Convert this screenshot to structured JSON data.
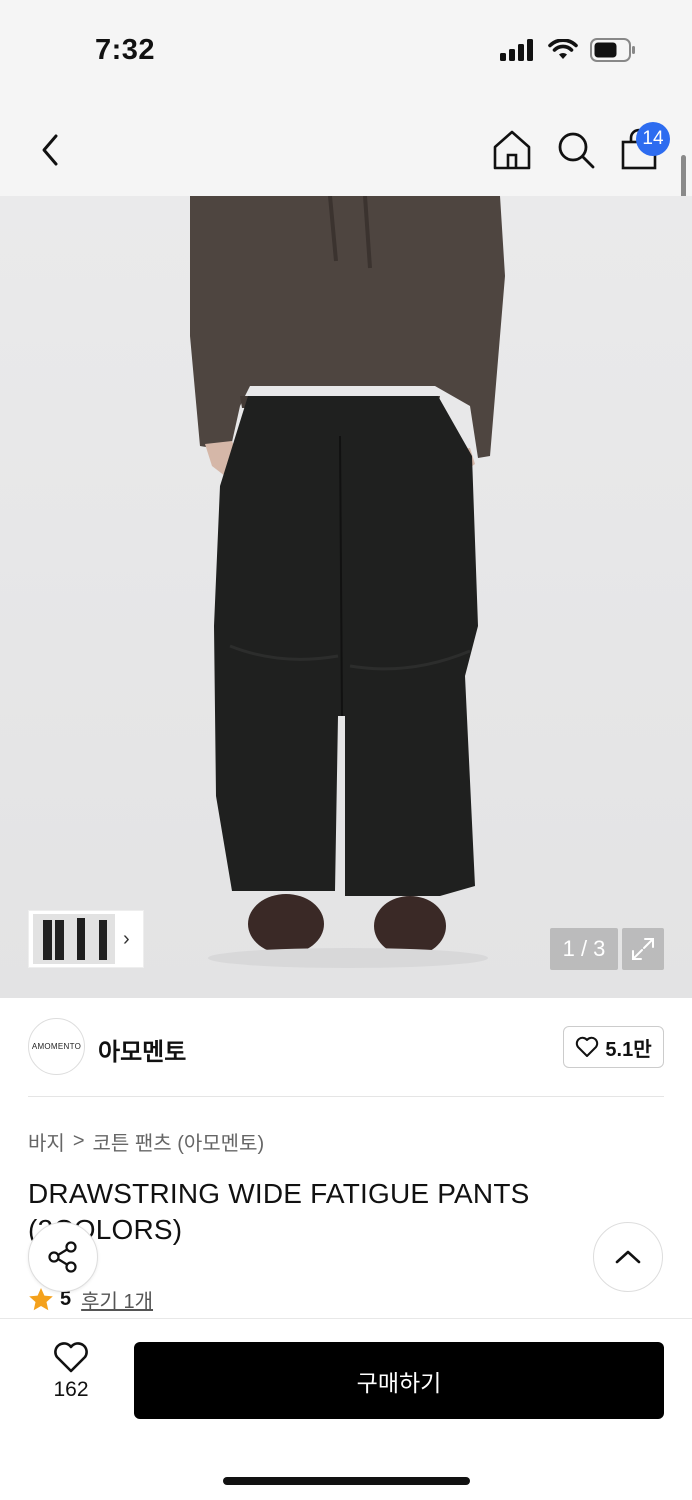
{
  "status_bar": {
    "time": "7:32"
  },
  "nav": {
    "cart_count": "14"
  },
  "gallery": {
    "page_counter": "1 / 3",
    "thumb_chevron": "›"
  },
  "brand": {
    "logo_text": "AMOMENTO",
    "name": "아모멘토",
    "likes": "5.1만"
  },
  "breadcrumb": {
    "category": "바지",
    "separator": ">",
    "subcategory": "코튼 팬츠 (아모멘토)"
  },
  "product": {
    "title": "DRAWSTRING WIDE FATIGUE PANTS (2COLORS)"
  },
  "rating": {
    "score": "5",
    "reviews": "후기 1개"
  },
  "bottom": {
    "wish_count": "162",
    "buy_label": "구매하기"
  },
  "colors": {
    "accent_badge": "#2d6cf0",
    "buy_button": "#000000",
    "star": "#f4a11c"
  }
}
